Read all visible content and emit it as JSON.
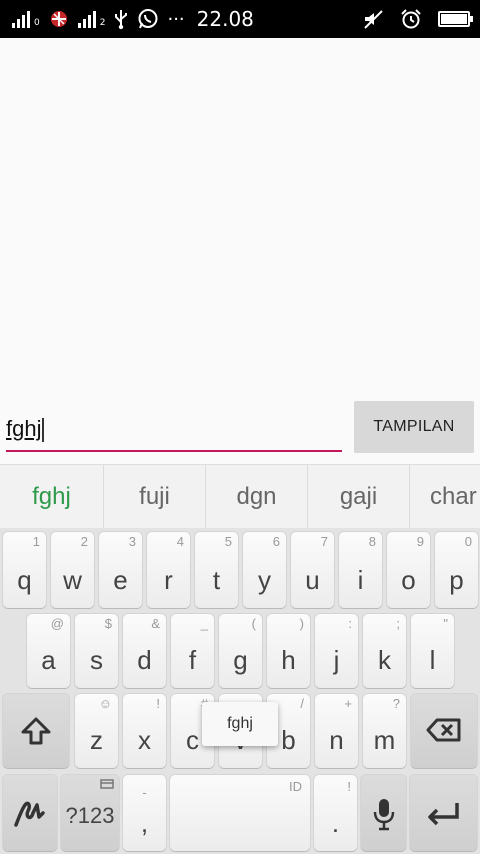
{
  "status_bar": {
    "sim1": "0",
    "sim2": "2",
    "more": "···",
    "time": "22.08",
    "battery_level": 1.0,
    "icons": [
      "signal-sim1-icon",
      "carrier-icon",
      "signal-sim2-icon",
      "usb-icon",
      "whatsapp-icon",
      "mute-icon",
      "alarm-icon",
      "battery-icon"
    ]
  },
  "input": {
    "value": "fghj"
  },
  "button": {
    "label": "TAMPILAN"
  },
  "suggestions": [
    "fghj",
    "fuji",
    "dgn",
    "gaji",
    "char"
  ],
  "keyboard": {
    "row1": [
      {
        "label": "q",
        "hint": "1"
      },
      {
        "label": "w",
        "hint": "2"
      },
      {
        "label": "e",
        "hint": "3"
      },
      {
        "label": "r",
        "hint": "4"
      },
      {
        "label": "t",
        "hint": "5"
      },
      {
        "label": "y",
        "hint": "6"
      },
      {
        "label": "u",
        "hint": "7"
      },
      {
        "label": "i",
        "hint": "8"
      },
      {
        "label": "o",
        "hint": "9"
      },
      {
        "label": "p",
        "hint": "0"
      }
    ],
    "row2": [
      {
        "label": "a",
        "hint": "@"
      },
      {
        "label": "s",
        "hint": "$"
      },
      {
        "label": "d",
        "hint": "&"
      },
      {
        "label": "f",
        "hint": "_"
      },
      {
        "label": "g",
        "hint": "("
      },
      {
        "label": "h",
        "hint": ")"
      },
      {
        "label": "j",
        "hint": ":"
      },
      {
        "label": "k",
        "hint": ";"
      },
      {
        "label": "l",
        "hint": "\""
      }
    ],
    "row3": [
      {
        "label": "z",
        "hint": "☺"
      },
      {
        "label": "x",
        "hint": "!"
      },
      {
        "label": "c",
        "hint": "#"
      },
      {
        "label": "v",
        "hint": "="
      },
      {
        "label": "b",
        "hint": "/"
      },
      {
        "label": "n",
        "hint": "+"
      },
      {
        "label": "m",
        "hint": "?"
      }
    ],
    "symbols_label": "?123",
    "comma": {
      "label": ",",
      "hint": "-"
    },
    "space_hint": "ID",
    "period": {
      "label": ".",
      "hint": "!"
    },
    "key_preview": "fghj"
  }
}
